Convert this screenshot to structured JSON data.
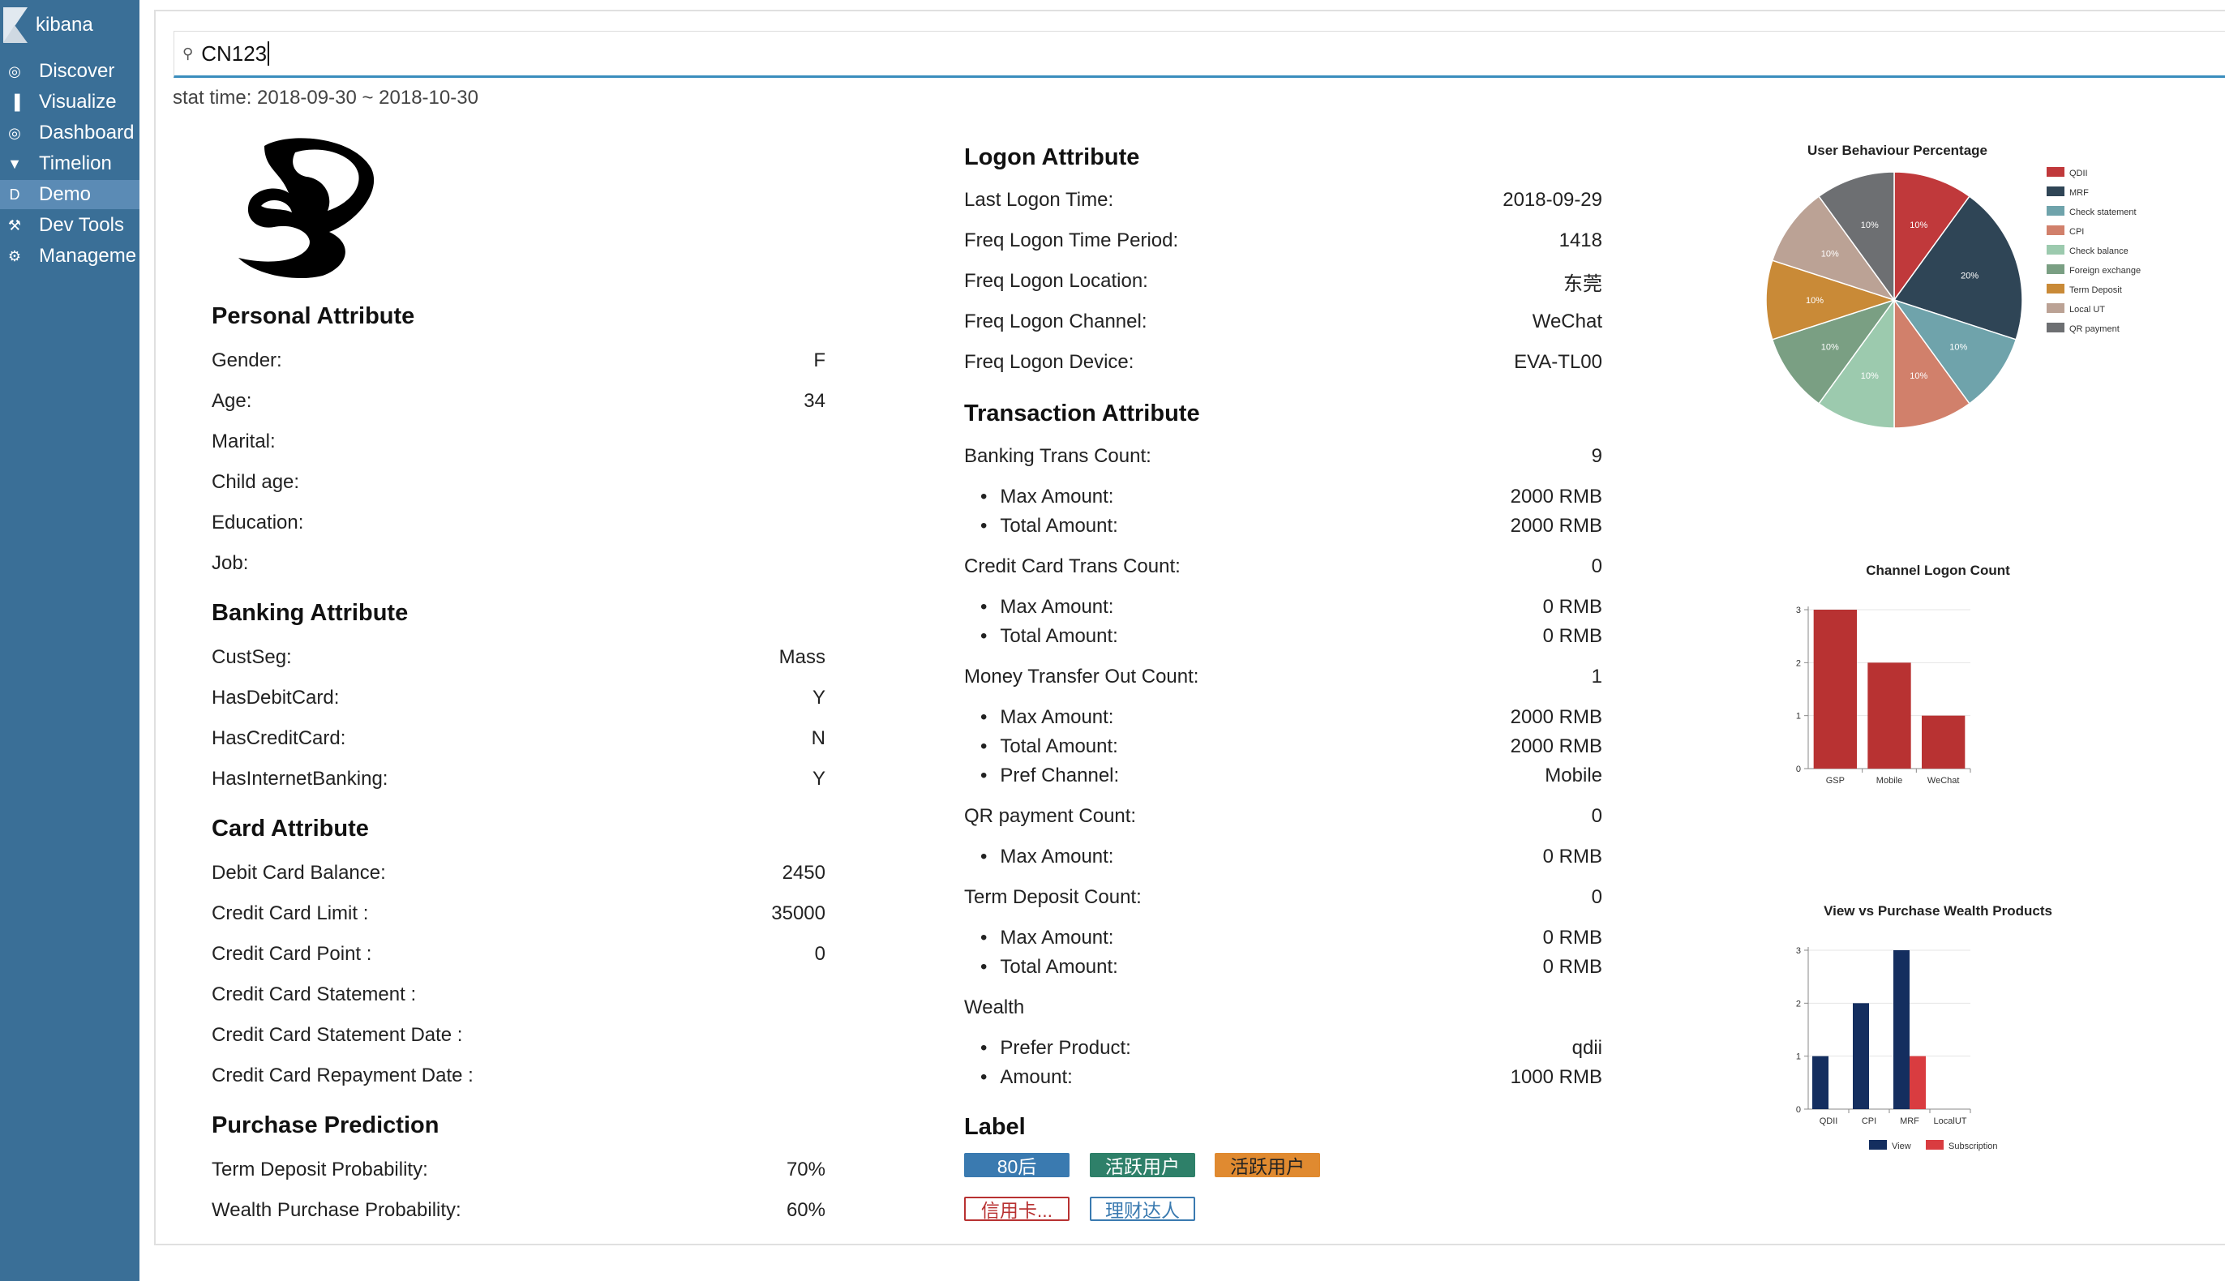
{
  "app": {
    "name": "kibana"
  },
  "sidebar": {
    "items": [
      {
        "label": "Discover",
        "icon": "compass-icon",
        "glyph": "◎"
      },
      {
        "label": "Visualize",
        "icon": "bar-chart-icon",
        "glyph": "▐"
      },
      {
        "label": "Dashboard",
        "icon": "dashboard-icon",
        "glyph": "◎"
      },
      {
        "label": "Timelion",
        "icon": "shield-icon",
        "glyph": "▼"
      },
      {
        "label": "Demo",
        "icon": "demo-letter-icon",
        "glyph": "D"
      },
      {
        "label": "Dev Tools",
        "icon": "wrench-icon",
        "glyph": "⚒"
      },
      {
        "label": "Manageme",
        "icon": "gear-icon",
        "glyph": "⚙"
      }
    ],
    "active_index": 4
  },
  "search": {
    "value": "CN123"
  },
  "stat_time": "stat time: 2018-09-30 ~ 2018-10-30",
  "personal": {
    "title": "Personal Attribute",
    "rows": [
      {
        "k": "Gender:",
        "v": "F"
      },
      {
        "k": "Age:",
        "v": "34"
      },
      {
        "k": "Marital:",
        "v": ""
      },
      {
        "k": "Child age:",
        "v": ""
      },
      {
        "k": "Education:",
        "v": ""
      },
      {
        "k": "Job:",
        "v": ""
      }
    ]
  },
  "banking": {
    "title": "Banking Attribute",
    "rows": [
      {
        "k": "CustSeg:",
        "v": "Mass"
      },
      {
        "k": "HasDebitCard:",
        "v": "Y"
      },
      {
        "k": "HasCreditCard:",
        "v": "N"
      },
      {
        "k": "HasInternetBanking:",
        "v": "Y"
      }
    ]
  },
  "card": {
    "title": "Card Attribute",
    "rows": [
      {
        "k": "Debit Card Balance:",
        "v": "2450"
      },
      {
        "k": "Credit Card Limit :",
        "v": "35000"
      },
      {
        "k": "Credit Card Point :",
        "v": "0"
      },
      {
        "k": "Credit Card Statement :",
        "v": ""
      },
      {
        "k": "Credit Card Statement Date :",
        "v": ""
      },
      {
        "k": "Credit Card Repayment Date :",
        "v": ""
      }
    ]
  },
  "prediction": {
    "title": "Purchase Prediction",
    "rows": [
      {
        "k": "Term Deposit Probability:",
        "v": "70%"
      },
      {
        "k": "Wealth Purchase Probability:",
        "v": "60%"
      }
    ]
  },
  "logon": {
    "title": "Logon Attribute",
    "rows": [
      {
        "k": "Last Logon Time:",
        "v": "2018-09-29"
      },
      {
        "k": "Freq Logon Time Period:",
        "v": "1418"
      },
      {
        "k": "Freq Logon Location:",
        "v": "东莞"
      },
      {
        "k": "Freq Logon Channel:",
        "v": "WeChat"
      },
      {
        "k": "Freq Logon Device:",
        "v": "EVA-TL00"
      }
    ]
  },
  "transaction": {
    "title": "Transaction Attribute",
    "rows": [
      {
        "k": "Banking Trans Count:",
        "v": "9",
        "bullet": false
      },
      {
        "k": "Max Amount:",
        "v": "2000 RMB",
        "bullet": true
      },
      {
        "k": "Total Amount:",
        "v": "2000 RMB",
        "bullet": true
      },
      {
        "k": "Credit Card Trans Count:",
        "v": "0",
        "bullet": false
      },
      {
        "k": "Max Amount:",
        "v": "0 RMB",
        "bullet": true
      },
      {
        "k": "Total Amount:",
        "v": "0 RMB",
        "bullet": true
      },
      {
        "k": "Money Transfer Out Count:",
        "v": "1",
        "bullet": false
      },
      {
        "k": "Max Amount:",
        "v": "2000 RMB",
        "bullet": true
      },
      {
        "k": "Total Amount:",
        "v": "2000 RMB",
        "bullet": true
      },
      {
        "k": "Pref Channel:",
        "v": "Mobile",
        "bullet": true
      },
      {
        "k": "QR payment Count:",
        "v": "0",
        "bullet": false
      },
      {
        "k": "Max Amount:",
        "v": "0 RMB",
        "bullet": true
      },
      {
        "k": "Term Deposit Count:",
        "v": "0",
        "bullet": false
      },
      {
        "k": "Max Amount:",
        "v": "0 RMB",
        "bullet": true
      },
      {
        "k": "Total Amount:",
        "v": "0 RMB",
        "bullet": true
      },
      {
        "k": "Wealth",
        "v": "",
        "bullet": false
      },
      {
        "k": "Prefer Product:",
        "v": "qdii",
        "bullet": true
      },
      {
        "k": "Amount:",
        "v": "1000 RMB",
        "bullet": true
      }
    ]
  },
  "labels": {
    "title": "Label",
    "tags": [
      {
        "text": "80后",
        "bg": "#3a7ab0",
        "fg": "#ffffff",
        "border": "#3a7ab0"
      },
      {
        "text": "活跃用户",
        "bg": "#2e8069",
        "fg": "#ffffff",
        "border": "#2e8069"
      },
      {
        "text": "活跃用户",
        "bg": "#e08a30",
        "fg": "#222222",
        "border": "#e08a30"
      },
      {
        "text": "信用卡...",
        "bg": "#ffffff",
        "fg": "#b83232",
        "border": "#b83232"
      },
      {
        "text": "理财达人",
        "bg": "#ffffff",
        "fg": "#3a7ab0",
        "border": "#3a7ab0"
      }
    ]
  },
  "chart_data": [
    {
      "type": "pie",
      "title": "User Behaviour Percentage",
      "legend_position": "right",
      "slices": [
        {
          "name": "QDII",
          "value": 10,
          "label": "10%",
          "color": "#c0393b"
        },
        {
          "name": "MRF",
          "value": 20,
          "label": "20%",
          "color": "#2f4556"
        },
        {
          "name": "Check statement",
          "value": 10,
          "label": "10%",
          "color": "#6fa3ab"
        },
        {
          "name": "CPI",
          "value": 10,
          "label": "10%",
          "color": "#d1806b"
        },
        {
          "name": "Check balance",
          "value": 10,
          "label": "10%",
          "color": "#9ccaae"
        },
        {
          "name": "Foreign exchange",
          "value": 10,
          "label": "10%",
          "color": "#7a9f83"
        },
        {
          "name": "Term Deposit",
          "value": 10,
          "label": "10%",
          "color": "#c98a37"
        },
        {
          "name": "Local UT",
          "value": 10,
          "label": "10%",
          "color": "#bba295"
        },
        {
          "name": "QR payment",
          "value": 10,
          "label": "10%",
          "color": "#6d6f72"
        }
      ]
    },
    {
      "type": "bar",
      "title": "Channel Logon Count",
      "categories": [
        "GSP",
        "Mobile",
        "WeChat"
      ],
      "values": [
        3,
        2,
        1
      ],
      "yticks": [
        "0",
        "1",
        "2",
        "3"
      ],
      "ylim": [
        0,
        3
      ],
      "color": "#b83232"
    },
    {
      "type": "bar",
      "title": "View vs  Purchase Wealth Products",
      "categories": [
        "QDII",
        "CPI",
        "MRF",
        "LocalUT"
      ],
      "yticks": [
        "0",
        "1",
        "2",
        "3"
      ],
      "ylim": [
        0,
        3
      ],
      "legend_position": "bottom",
      "series": [
        {
          "name": "View",
          "values": [
            1,
            2,
            3,
            0
          ],
          "color": "#142e5f"
        },
        {
          "name": "Subscription",
          "values": [
            0,
            0,
            1,
            0
          ],
          "color": "#d93c40"
        }
      ]
    }
  ]
}
